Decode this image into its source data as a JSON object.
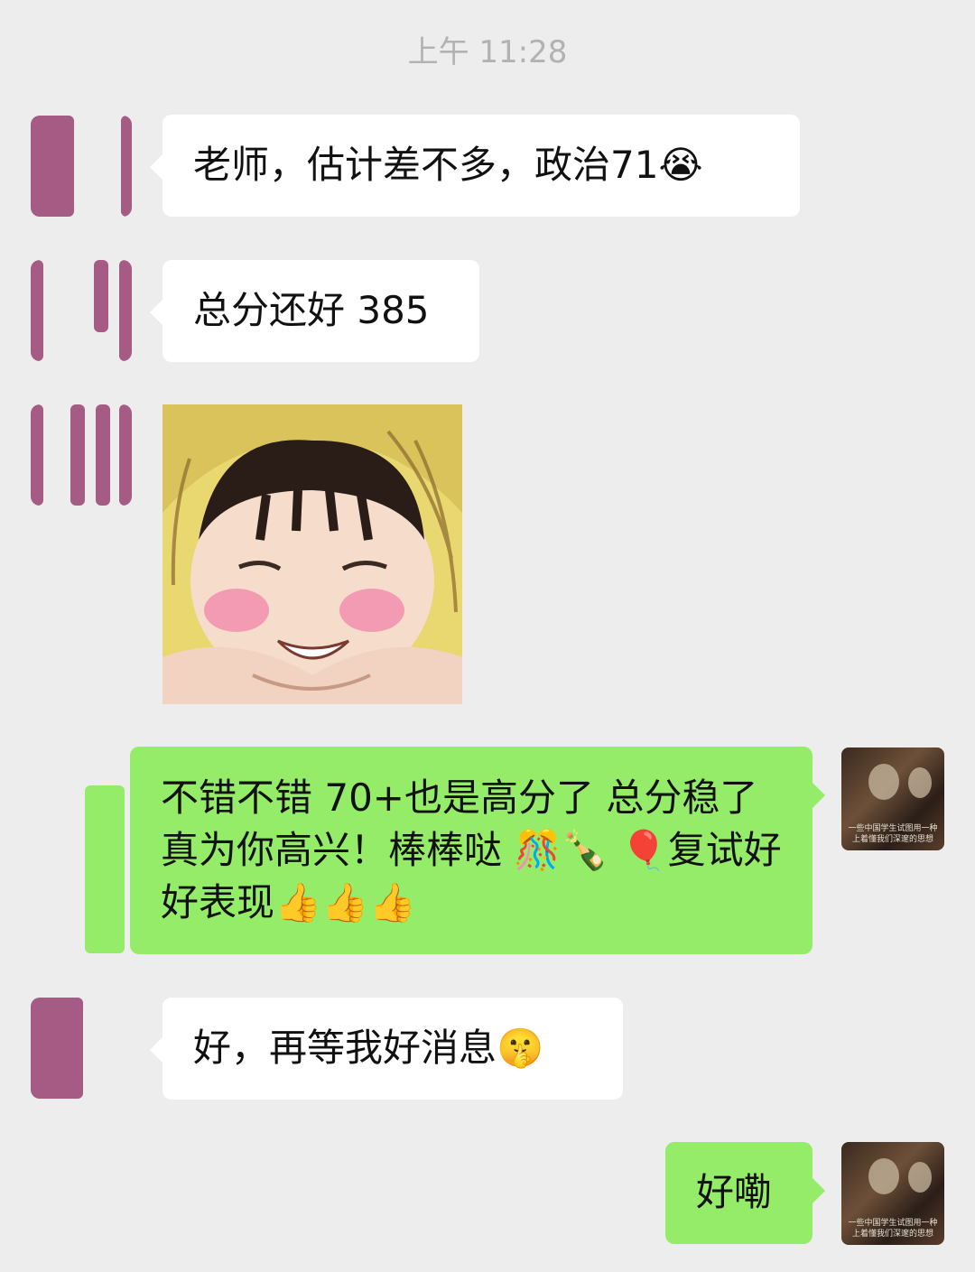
{
  "chat": {
    "timestamp": "上午 11:28",
    "messages": [
      {
        "side": "in",
        "text": "老师，估计差不多，政治71😭"
      },
      {
        "side": "in",
        "text": "总分还好 385"
      },
      {
        "side": "in",
        "type": "sticker",
        "sticker": "baby-blush-sticker"
      },
      {
        "side": "out",
        "text": "不错不错 70+也是高分了 总分稳了 真为你高兴！棒棒哒 🎊🍾 🎈复试好好表现👍👍👍"
      },
      {
        "side": "in",
        "text": "好，再等我好消息🤫"
      },
      {
        "side": "out",
        "text": "好嘞"
      }
    ],
    "my_avatar_caption": "一些中国学生试图用一种上着懂我们深邃的思想"
  },
  "colors": {
    "background": "#ededed",
    "incoming_bubble": "#ffffff",
    "outgoing_bubble": "#95ec69",
    "avatar_blot": "#a55b83"
  }
}
